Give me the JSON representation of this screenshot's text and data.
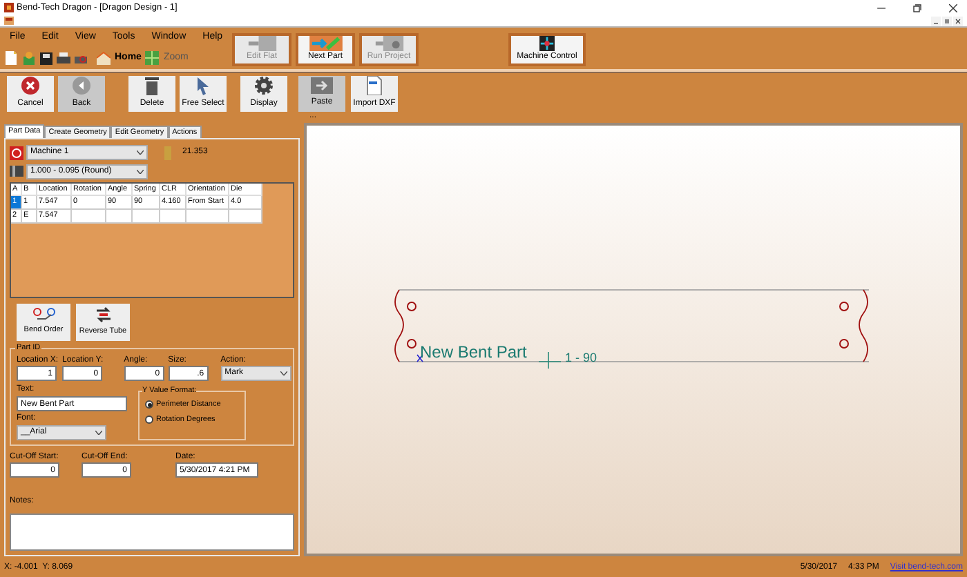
{
  "window": {
    "title": "Bend-Tech Dragon - [Dragon Design - 1]"
  },
  "menu": [
    "File",
    "Edit",
    "View",
    "Tools",
    "Window",
    "Help"
  ],
  "quick_toolbar": [
    {
      "label": "Home"
    },
    {
      "label": "Zoom"
    }
  ],
  "mode_buttons": [
    {
      "label": "Edit Flat",
      "disabled": true
    },
    {
      "label": "Next Part",
      "disabled": false
    },
    {
      "label": "Run Project",
      "disabled": true
    }
  ],
  "machine_control": {
    "label": "Machine Control"
  },
  "actions": [
    {
      "label": "Cancel",
      "disabled": false
    },
    {
      "label": "Back",
      "disabled": true
    },
    {
      "label": "Delete",
      "disabled": false
    },
    {
      "label": "Free Select",
      "disabled": false
    },
    {
      "label": "Display",
      "disabled": false
    },
    {
      "label": "Paste",
      "disabled": true
    },
    {
      "label": "Import DXF",
      "disabled": false
    }
  ],
  "splitter": "...",
  "tabs": [
    {
      "label": "Part Data",
      "selected": true
    },
    {
      "label": "Create Geometry",
      "selected": false
    },
    {
      "label": "Edit Geometry",
      "selected": false
    },
    {
      "label": "Actions",
      "selected": false
    }
  ],
  "machine": {
    "value": "Machine 1",
    "length": "21.353"
  },
  "material": {
    "value": "1.000 - 0.095 (Round)"
  },
  "table": {
    "columns": [
      "A",
      "B",
      "Location",
      "Rotation",
      "Angle",
      "Spring",
      "CLR",
      "Orientation",
      "Die"
    ],
    "rows": [
      {
        "cells": [
          "1",
          "1",
          "7.547",
          "0",
          "90",
          "90",
          "4.160",
          "From Start",
          "4.0"
        ],
        "selected": true
      },
      {
        "cells": [
          "2",
          "E",
          "7.547",
          "",
          "",
          "",
          "",
          "",
          ""
        ],
        "selected": false
      }
    ]
  },
  "tube_buttons": [
    "Bend Order",
    "Reverse Tube"
  ],
  "part_id": {
    "title": "Part ID",
    "fields": [
      {
        "label": "Location X:",
        "value": "1"
      },
      {
        "label": "Location Y:",
        "value": "0"
      },
      {
        "label": "Angle:",
        "value": "0"
      },
      {
        "label": "Size:",
        "value": ".6"
      }
    ],
    "action": {
      "label": "Action:",
      "value": "Mark"
    },
    "text": {
      "label": "Text:",
      "value": "New Bent Part"
    },
    "font": {
      "label": "Font:",
      "value": "__Arial"
    },
    "y_value_format": {
      "title": "Y Value Format:",
      "options": [
        {
          "label": "Perimeter Distance",
          "selected": true
        },
        {
          "label": "Rotation Degrees",
          "selected": false
        }
      ]
    }
  },
  "cut_off_start": {
    "label": "Cut-Off Start:",
    "value": "0"
  },
  "cut_off_end": {
    "label": "Cut-Off End:",
    "value": "0"
  },
  "date": {
    "label": "Date:",
    "value": "5/30/2017 4:21 PM"
  },
  "notes": {
    "label": "Notes:"
  },
  "canvas": {
    "part_label": "New Bent Part",
    "bend_label": "1 - 90"
  },
  "status_bar": {
    "coords": "X: -4.001  Y: 8.069",
    "date": "5/30/2017",
    "time": "4:33 PM",
    "link": "Visit bend-tech.com"
  }
}
